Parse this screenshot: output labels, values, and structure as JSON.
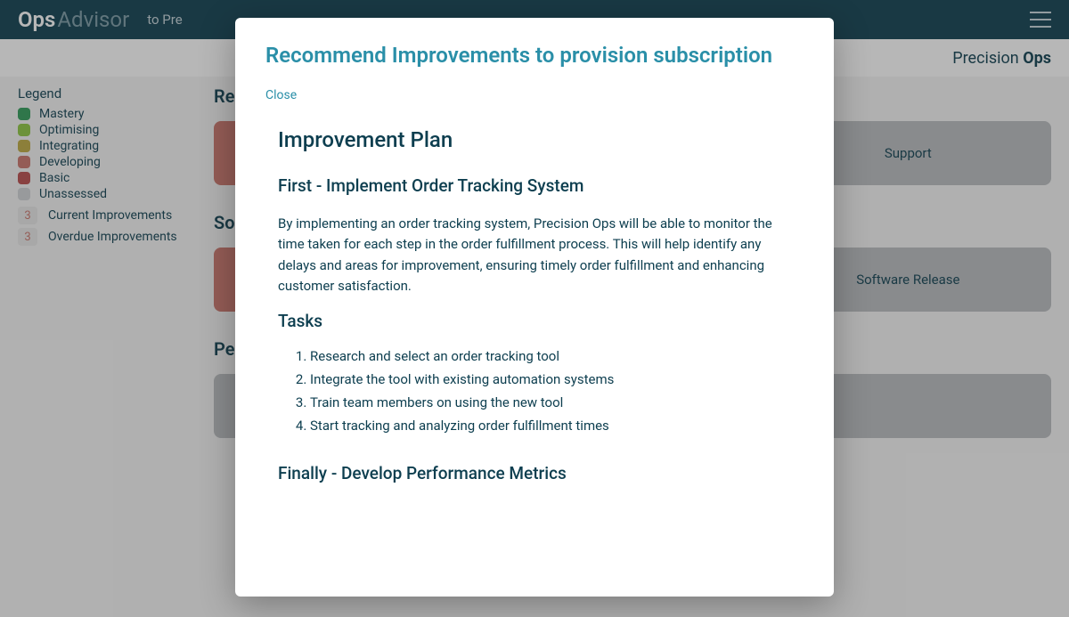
{
  "header": {
    "logo_ops": "Ops",
    "logo_advisor": "Advisor",
    "tagline": "to Pre"
  },
  "subheader": {
    "brand_left": "Precision ",
    "brand_right": "Ops"
  },
  "legend": {
    "title": "Legend",
    "items": [
      {
        "label": "Mastery",
        "color": "#2e9b58"
      },
      {
        "label": "Optimising",
        "color": "#8dc63f"
      },
      {
        "label": "Integrating",
        "color": "#bda93f"
      },
      {
        "label": "Developing",
        "color": "#c9746a"
      },
      {
        "label": "Basic",
        "color": "#b84a4a"
      },
      {
        "label": "Unassessed",
        "color": "#cfd3d6"
      }
    ],
    "counters": [
      {
        "count": "3",
        "label": "Current Improvements"
      },
      {
        "count": "3",
        "label": "Overdue Improvements"
      }
    ]
  },
  "sections": [
    {
      "title": "Re",
      "cards": [
        {
          "label": "",
          "cls": "card-wide"
        },
        {
          "label": "Support",
          "cls": "card-grey"
        }
      ]
    },
    {
      "title": "So",
      "cards": [
        {
          "label": "",
          "cls": "card-wide"
        },
        {
          "label": "Software Release",
          "cls": "card-grey"
        }
      ]
    },
    {
      "title": "Pe",
      "cards": [
        {
          "label": "",
          "cls": "card-grey",
          "style": "flex:2"
        }
      ]
    }
  ],
  "modal": {
    "title": "Recommend Improvements to provision subscription",
    "close": "Close",
    "plan_heading": "Improvement Plan",
    "first_heading": "First - Implement Order Tracking System",
    "first_body": "By implementing an order tracking system, Precision Ops will be able to monitor the time taken for each step in the order fulfillment process. This will help identify any delays and areas for improvement, ensuring timely order fulfillment and enhancing customer satisfaction.",
    "tasks_heading": "Tasks",
    "tasks": [
      "Research and select an order tracking tool",
      "Integrate the tool with existing automation systems",
      "Train team members on using the new tool",
      "Start tracking and analyzing order fulfillment times"
    ],
    "finally_heading": "Finally - Develop Performance Metrics"
  }
}
